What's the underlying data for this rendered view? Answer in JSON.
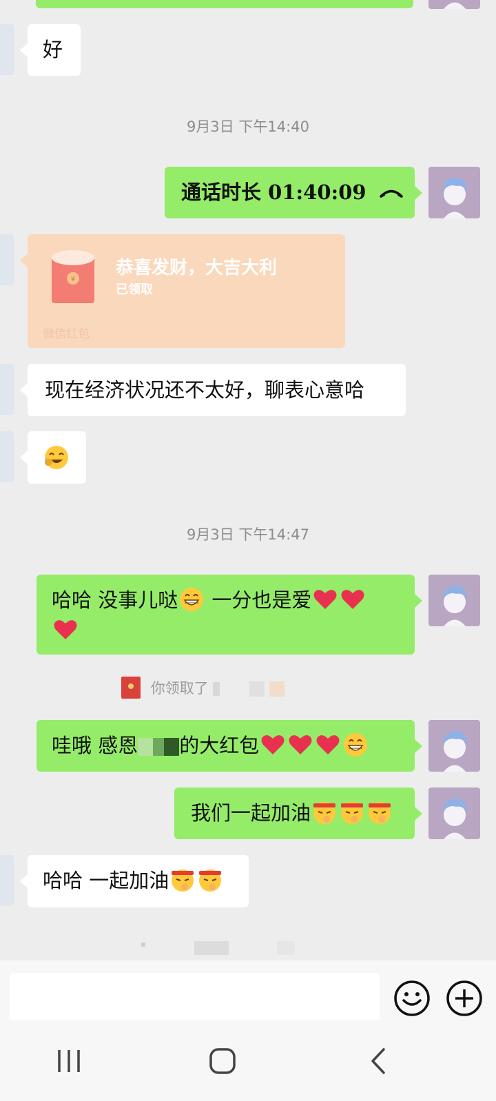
{
  "messages": {
    "m0": {
      "text": "好"
    },
    "m1": {
      "label": "通话时长 01:40:09"
    },
    "m2": {
      "title": "恭喜发财，大吉大利",
      "status": "已领取",
      "footer": "微信红包"
    },
    "m3": {
      "text": "现在经济状况还不太好，聊表心意哈"
    },
    "m5": {
      "part1": "哈哈  没事儿哒",
      "part2": " 一分也是爱"
    },
    "m6": {
      "text": "你领取了"
    },
    "m7": {
      "part1": "哇哦  感恩",
      "part2": "的大红包"
    },
    "m8": {
      "text": "我们一起加油"
    },
    "m9": {
      "text": "哈哈 一起加油"
    }
  },
  "timestamps": [
    "9月3日 下午14:40",
    "9月3日 下午14:47"
  ],
  "icons": [
    "phone-hangup-icon",
    "red-packet-icon",
    "laugh-cry-emoji",
    "grin-emoji",
    "heart-emoji",
    "fighting-emoji",
    "emoji-button-icon",
    "plus-button-icon",
    "recent-apps-icon",
    "home-icon",
    "back-icon"
  ],
  "colors": {
    "outgoing_bubble": "#95ec69",
    "incoming_bubble": "#ffffff",
    "red_packet": "#fad8bc",
    "background": "#ededed"
  }
}
